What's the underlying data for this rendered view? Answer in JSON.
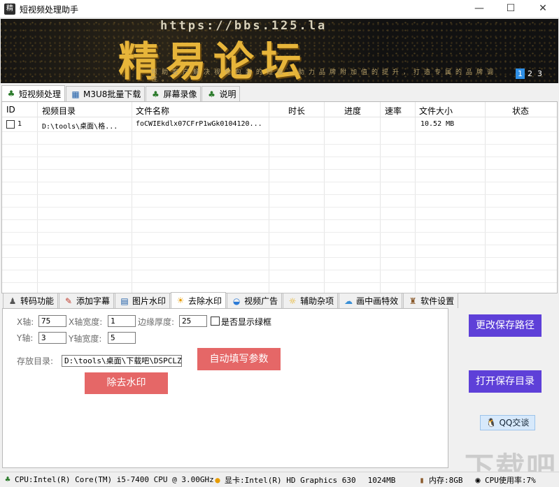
{
  "window": {
    "title": "短视频处理助手",
    "minimize": "—",
    "maximize": "☐",
    "close": "✕",
    "app_icon": "精"
  },
  "banner": {
    "url": "https://bbs.125.la",
    "logo": "精易论坛",
    "slogan": "帮助客户解决视觉包装的短板，助力品牌附加值的提升，打造专属的品牌调性。",
    "pages": [
      "1",
      "2",
      "3"
    ],
    "active_page": "1"
  },
  "top_tabs": [
    {
      "label": "短视频处理",
      "icon": "video-icon",
      "glyph": "♣",
      "active": true
    },
    {
      "label": "M3U8批量下载",
      "icon": "table-icon",
      "glyph": "▦",
      "active": false
    },
    {
      "label": "屏幕录像",
      "icon": "screen-record-icon",
      "glyph": "♣",
      "active": false
    },
    {
      "label": "说明",
      "icon": "help-icon",
      "glyph": "♣",
      "active": false
    }
  ],
  "table": {
    "columns": [
      "ID",
      "视频目录",
      "文件名称",
      "时长",
      "进度",
      "速率",
      "文件大小",
      "状态"
    ],
    "rows": [
      {
        "id": "1",
        "dir": "D:\\tools\\桌面\\格...",
        "name": "foCWIEkdlx07CFrP1wGk0104120...",
        "duration": "",
        "progress": "",
        "rate": "",
        "size": "10.52 MB",
        "status": ""
      }
    ]
  },
  "bottom_tabs": [
    {
      "label": "转码功能",
      "icon": "transcode-icon",
      "glyph": "♟",
      "active": false
    },
    {
      "label": "添加字幕",
      "icon": "subtitle-icon",
      "glyph": "✎",
      "active": false
    },
    {
      "label": "图片水印",
      "icon": "image-watermark-icon",
      "glyph": "▤",
      "active": false
    },
    {
      "label": "去除水印",
      "icon": "sun-icon",
      "glyph": "☀",
      "active": true
    },
    {
      "label": "视频广告",
      "icon": "video-ad-icon",
      "glyph": "◒",
      "active": false
    },
    {
      "label": "辅助杂项",
      "icon": "misc-icon",
      "glyph": "☼",
      "active": false
    },
    {
      "label": "画中画特效",
      "icon": "pip-icon",
      "glyph": "☁",
      "active": false
    },
    {
      "label": "软件设置",
      "icon": "settings-icon",
      "glyph": "♜",
      "active": false
    }
  ],
  "form": {
    "x_label": "X轴:",
    "x_value": "75",
    "x_width_label": "X轴宽度:",
    "x_width_value": "1",
    "edge_label": "边缘厚度:",
    "edge_value": "25",
    "show_border_label": "是否显示绿框",
    "y_label": "Y轴:",
    "y_value": "3",
    "y_width_label": "Y轴宽度:",
    "y_width_value": "5",
    "dir_label": "存放目录:",
    "dir_value": "D:\\tools\\桌面\\下载吧\\DSPCLZS",
    "auto_fill_button": "自动填写参数",
    "remove_button": "除去水印"
  },
  "side": {
    "change_path_button": "更改保存路径",
    "open_dir_button": "打开保存目录",
    "qq_button": "QQ交谈"
  },
  "status": {
    "cpu": "CPU:Intel(R) Core(TM) i5-7400 CPU @ 3.00GHz",
    "gpu": "显卡:Intel(R) HD Graphics 630",
    "vram": "1024MB",
    "memory": "内存:8GB",
    "cpu_usage": "CPU使用率:7%"
  },
  "colors": {
    "red_button": "#e56767",
    "purple_button": "#5e40d8",
    "active_page": "#2f8fe6",
    "logo_gold": "#e7b53a"
  }
}
